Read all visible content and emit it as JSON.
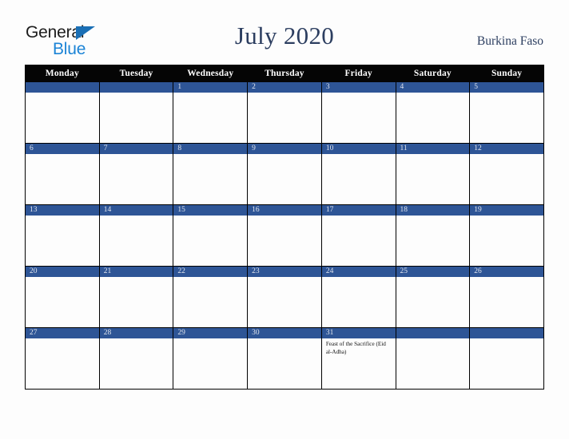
{
  "brand": {
    "name_part1": "General",
    "name_part2": "Blue",
    "triangle_color": "#1a6fb5",
    "blue_color": "#1c84d6"
  },
  "header": {
    "title": "July 2020",
    "country": "Burkina Faso",
    "title_color": "#2c3e60"
  },
  "calendar": {
    "accent_color": "#2e5596",
    "header_bg": "#050505",
    "weekdays": [
      "Monday",
      "Tuesday",
      "Wednesday",
      "Thursday",
      "Friday",
      "Saturday",
      "Sunday"
    ],
    "weeks": [
      [
        {
          "date": "",
          "event": ""
        },
        {
          "date": "",
          "event": ""
        },
        {
          "date": "1",
          "event": ""
        },
        {
          "date": "2",
          "event": ""
        },
        {
          "date": "3",
          "event": ""
        },
        {
          "date": "4",
          "event": ""
        },
        {
          "date": "5",
          "event": ""
        }
      ],
      [
        {
          "date": "6",
          "event": ""
        },
        {
          "date": "7",
          "event": ""
        },
        {
          "date": "8",
          "event": ""
        },
        {
          "date": "9",
          "event": ""
        },
        {
          "date": "10",
          "event": ""
        },
        {
          "date": "11",
          "event": ""
        },
        {
          "date": "12",
          "event": ""
        }
      ],
      [
        {
          "date": "13",
          "event": ""
        },
        {
          "date": "14",
          "event": ""
        },
        {
          "date": "15",
          "event": ""
        },
        {
          "date": "16",
          "event": ""
        },
        {
          "date": "17",
          "event": ""
        },
        {
          "date": "18",
          "event": ""
        },
        {
          "date": "19",
          "event": ""
        }
      ],
      [
        {
          "date": "20",
          "event": ""
        },
        {
          "date": "21",
          "event": ""
        },
        {
          "date": "22",
          "event": ""
        },
        {
          "date": "23",
          "event": ""
        },
        {
          "date": "24",
          "event": ""
        },
        {
          "date": "25",
          "event": ""
        },
        {
          "date": "26",
          "event": ""
        }
      ],
      [
        {
          "date": "27",
          "event": ""
        },
        {
          "date": "28",
          "event": ""
        },
        {
          "date": "29",
          "event": ""
        },
        {
          "date": "30",
          "event": ""
        },
        {
          "date": "31",
          "event": "Feast of the Sacrifice (Eid al-Adha)"
        },
        {
          "date": "",
          "event": ""
        },
        {
          "date": "",
          "event": ""
        }
      ]
    ]
  }
}
